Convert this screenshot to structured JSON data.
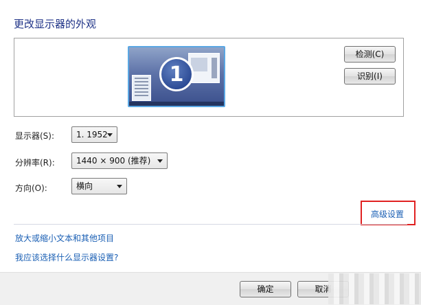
{
  "page": {
    "title": "更改显示器的外观"
  },
  "preview": {
    "monitor_number": "1",
    "detect_label": "检测(C)",
    "identify_label": "识别(I)"
  },
  "settings": {
    "display": {
      "label": "显示器(S):",
      "value": "1. 1952"
    },
    "resolution": {
      "label": "分辨率(R):",
      "value": "1440 × 900 (推荐)"
    },
    "orientation": {
      "label": "方向(O):",
      "value": "横向"
    }
  },
  "advanced_link": "高级设置",
  "links": {
    "text_size": "放大或缩小文本和其他项目",
    "which_settings": "我应该选择什么显示器设置?"
  },
  "footer": {
    "ok_label": "确定",
    "cancel_label": "取消"
  },
  "colors": {
    "title": "#1e3287",
    "link": "#1a5fb4",
    "highlight": "#e02020",
    "monitor_border": "#5aa7e3"
  }
}
